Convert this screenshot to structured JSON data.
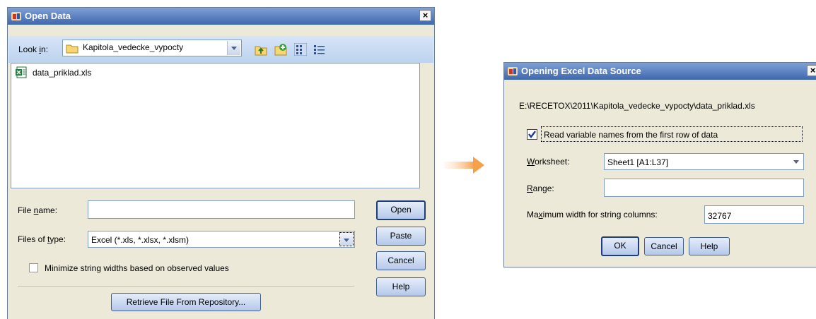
{
  "open_dialog": {
    "title": "Open Data",
    "close": "×",
    "look_in_label": "Look in:",
    "look_in_value": "Kapitola_vedecke_vypocty",
    "toolbar_icons": [
      "up-folder-icon",
      "new-folder-icon",
      "list-view-icon",
      "details-view-icon"
    ],
    "files": [
      {
        "name": "data_priklad.xls",
        "icon": "excel-file-icon"
      }
    ],
    "file_name_label": "File name:",
    "file_name_value": "",
    "files_of_type_label": "Files of type:",
    "files_of_type_value": "Excel (*.xls, *.xlsx, *.xlsm)",
    "minimize_label": "Minimize string widths based on observed values",
    "minimize_checked": false,
    "retrieve_button": "Retrieve File From Repository...",
    "buttons": {
      "open": "Open",
      "paste": "Paste",
      "cancel": "Cancel",
      "help": "Help"
    }
  },
  "excel_dialog": {
    "title": "Opening Excel Data Source",
    "close": "×",
    "path": "E:\\RECETOX\\2011\\Kapitola_vedecke_vypocty\\data_priklad.xls",
    "read_names_label": "Read variable names from the first row of data",
    "read_names_checked": true,
    "worksheet_label": "Worksheet:",
    "worksheet_value": "Sheet1 [A1:L37]",
    "range_label": "Range:",
    "range_value": "",
    "max_width_label": "Maximum width for string columns:",
    "max_width_value": "32767",
    "buttons": {
      "ok": "OK",
      "cancel": "Cancel",
      "help": "Help"
    }
  },
  "colors": {
    "arrow": "#f7a04a",
    "title_bar": "#3f67ad",
    "dialog_bg": "#ece9d8"
  }
}
